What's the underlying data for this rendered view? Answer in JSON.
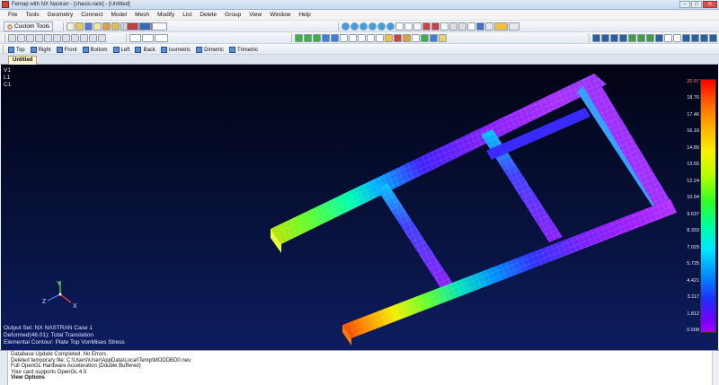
{
  "window": {
    "title": "Femap with NX Nastran - [chasis-rack] - [Untitled]",
    "controls": [
      "–",
      "□",
      "✕"
    ]
  },
  "menu": [
    "File",
    "Tools",
    "Geometry",
    "Connect",
    "Model",
    "Mesh",
    "Modify",
    "List",
    "Delete",
    "Group",
    "View",
    "Window",
    "Help"
  ],
  "toolbar": {
    "custom_tools_label": "Custom Tools"
  },
  "view_buttons": [
    "Top",
    "Right",
    "Front",
    "Bottom",
    "Left",
    "Back",
    "Isometric",
    "Dimetric",
    "Trimetric"
  ],
  "tab": {
    "label": "Untitled"
  },
  "viewport": {
    "corner_labels": [
      "V1",
      "L1",
      "C1"
    ],
    "triad_labels": {
      "x": "X",
      "y": "Y",
      "z": "Z"
    },
    "output_info": [
      "Output Set: NX NASTRAN Case 1",
      "Deformed(46.01): Total Translation",
      "Elemental Contour: Plate Top VonMises Stress"
    ]
  },
  "legend": {
    "values": [
      "20.97",
      "18.76",
      "17.46",
      "16.16",
      "14.85",
      "13.55",
      "12.24",
      "10.94",
      "9.637",
      "8.333",
      "7.029",
      "5.725",
      "4.421",
      "3.117",
      "1.812",
      "0.508"
    ]
  },
  "messages": [
    "Database Update Completed. No Errors.",
    "Deleted temporary file: C:\\Users\\User\\AppData\\Local\\Temp\\MODDBD0.neu",
    "Full OpenGL Hardware Acceleration (Double Buffered)",
    "Your card supports OpenGL 4.5",
    "View Options"
  ],
  "colors": {
    "viewport_top": "#020414",
    "viewport_bottom": "#0d1d60",
    "tab_bg": "#fff7d6"
  }
}
